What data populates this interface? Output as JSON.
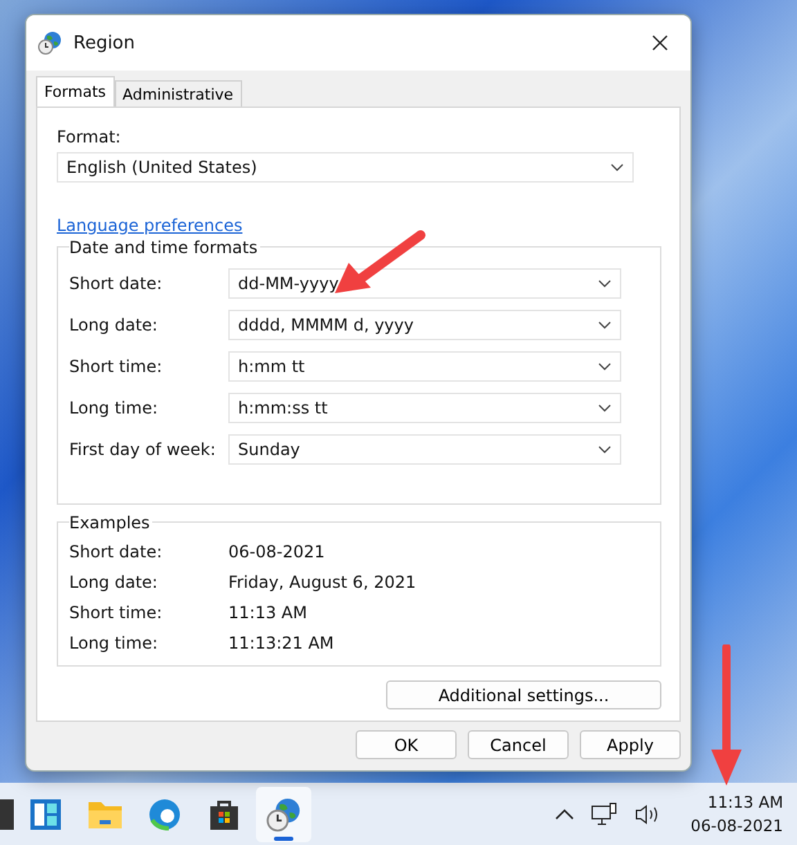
{
  "window": {
    "title": "Region"
  },
  "tabs": [
    {
      "label": "Formats",
      "selected": true
    },
    {
      "label": "Administrative",
      "selected": false
    }
  ],
  "format": {
    "label": "Format:",
    "value": "English (United States)"
  },
  "language_link": "Language preferences",
  "date_time_formats": {
    "title": "Date and time formats",
    "fields": [
      {
        "label": "Short date:",
        "value": "dd-MM-yyyy"
      },
      {
        "label": "Long date:",
        "value": "dddd, MMMM d, yyyy"
      },
      {
        "label": "Short time:",
        "value": "h:mm tt"
      },
      {
        "label": "Long time:",
        "value": "h:mm:ss tt"
      },
      {
        "label": "First day of week:",
        "value": "Sunday"
      }
    ]
  },
  "examples": {
    "title": "Examples",
    "rows": [
      {
        "label": "Short date:",
        "value": "06-08-2021"
      },
      {
        "label": "Long date:",
        "value": "Friday, August 6, 2021"
      },
      {
        "label": "Short time:",
        "value": "11:13 AM"
      },
      {
        "label": "Long time:",
        "value": "11:13:21 AM"
      }
    ]
  },
  "additional_button": "Additional settings...",
  "buttons": [
    "OK",
    "Cancel",
    "Apply"
  ],
  "taskbar": {
    "apps": [
      {
        "kind": "widgets",
        "selected": false
      },
      {
        "kind": "folder",
        "selected": false
      },
      {
        "kind": "edge",
        "selected": false
      },
      {
        "kind": "store",
        "selected": false
      },
      {
        "kind": "region",
        "selected": true
      }
    ],
    "time": "11:13 AM",
    "date": "06-08-2021"
  }
}
